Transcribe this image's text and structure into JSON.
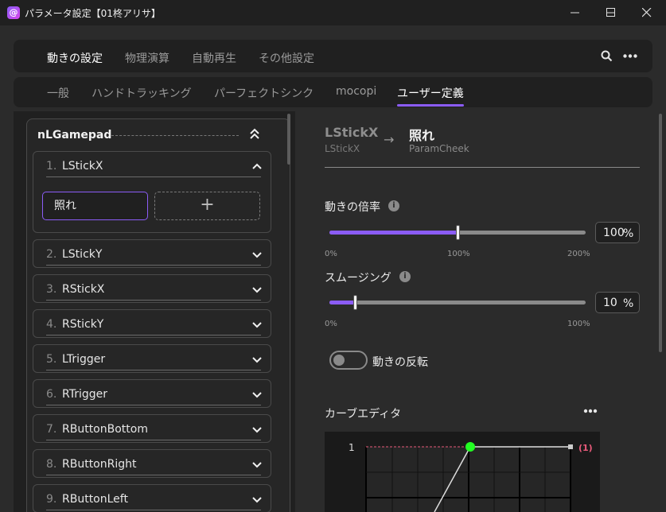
{
  "window": {
    "title": "パラメータ設定【01柊アリサ】",
    "app_icon": "app-logo-icon"
  },
  "main_tabs": [
    {
      "label": "動きの設定",
      "active": true
    },
    {
      "label": "物理演算",
      "active": false
    },
    {
      "label": "自動再生",
      "active": false
    },
    {
      "label": "その他設定",
      "active": false
    }
  ],
  "sub_tabs": [
    {
      "label": "一般",
      "active": false
    },
    {
      "label": "ハンドトラッキング",
      "active": false
    },
    {
      "label": "パーフェクトシンク",
      "active": false
    },
    {
      "label": "mocopi",
      "active": false
    },
    {
      "label": "ユーザー定義",
      "active": true
    }
  ],
  "group": {
    "title": "nLGamepad",
    "expanded_item": {
      "number": "1.",
      "name": "LStickX",
      "params": [
        "照れ"
      ],
      "add_symbol": "+"
    },
    "items": [
      {
        "number": "2.",
        "name": "LStickY"
      },
      {
        "number": "3.",
        "name": "RStickX"
      },
      {
        "number": "4.",
        "name": "RStickY"
      },
      {
        "number": "5.",
        "name": "LTrigger"
      },
      {
        "number": "6.",
        "name": "RTrigger"
      },
      {
        "number": "7.",
        "name": "RButtonBottom"
      },
      {
        "number": "8.",
        "name": "RButtonRight"
      },
      {
        "number": "9.",
        "name": "RButtonLeft"
      }
    ]
  },
  "mapping": {
    "source_name": "LStickX",
    "source_sub": "LStickX",
    "arrow": "→",
    "target_name": "照れ",
    "target_sub": "ParamCheek"
  },
  "motion_scale": {
    "label": "動きの倍率",
    "value": "100",
    "unit": "%",
    "fraction": 0.5,
    "ticks": [
      "0%",
      "100%",
      "200%"
    ]
  },
  "smoothing": {
    "label": "スムージング",
    "value": "10",
    "unit": "%",
    "fraction": 0.1,
    "ticks": [
      "0%",
      "100%"
    ]
  },
  "invert": {
    "label": "動きの反転",
    "on": false
  },
  "curve_editor": {
    "title": "カーブエディタ",
    "y_top_label": "1",
    "point_label": "(1)"
  },
  "colors": {
    "accent": "#8b5cf6",
    "curve_point": "#22ff22",
    "marker": "#e85a7a"
  }
}
